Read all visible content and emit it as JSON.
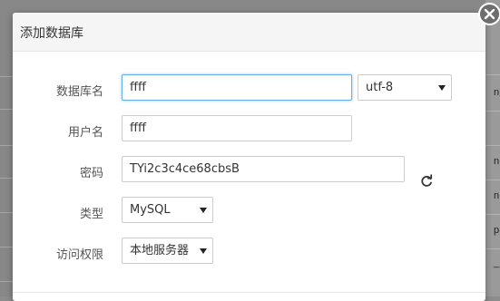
{
  "dialog": {
    "title": "添加数据库"
  },
  "form": {
    "db_name": {
      "label": "数据库名",
      "value": "ffff"
    },
    "charset": {
      "selected": "utf-8"
    },
    "username": {
      "label": "用户名",
      "value": "ffff"
    },
    "password": {
      "label": "密码",
      "value": "TYi2c3c4ce68cbsB"
    },
    "type": {
      "label": "类型",
      "selected": "MySQL"
    },
    "access": {
      "label": "访问权限",
      "selected": "本地服务器"
    }
  },
  "background": {
    "right_fragments": [
      "n",
      "n",
      "n",
      "p",
      "_"
    ]
  },
  "icons": {
    "close": "close-icon",
    "refresh": "refresh-icon",
    "dropdown": "chevron-down-icon"
  },
  "colors": {
    "focus_border": "#66afe9",
    "close_bg": "#6e6e6e",
    "header_bg": "#f5f5f5"
  }
}
